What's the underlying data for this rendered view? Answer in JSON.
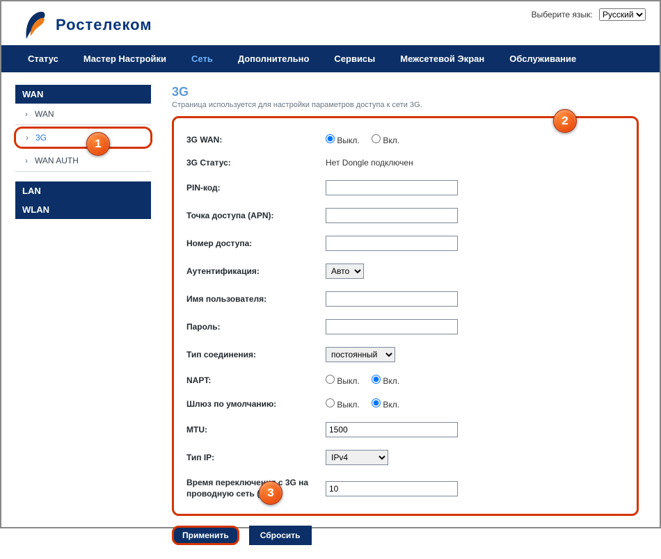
{
  "header": {
    "lang_label": "Выберите язык:",
    "lang_value": "Русский",
    "brand": "Ростелеком"
  },
  "nav": {
    "items": [
      "Статус",
      "Мастер Настройки",
      "Сеть",
      "Дополнительно",
      "Сервисы",
      "Межсетевой Экран",
      "Обслуживание"
    ],
    "active_index": 2
  },
  "sidebar": {
    "groups": [
      {
        "title": "WAN",
        "items": [
          "WAN",
          "3G",
          "WAN AUTH"
        ],
        "active_index": 1
      },
      {
        "title": "LAN",
        "items": []
      },
      {
        "title": "WLAN",
        "items": []
      }
    ]
  },
  "page": {
    "title": "3G",
    "desc": "Страница используется для настройки параметров доступа к сети 3G."
  },
  "form": {
    "wan": {
      "label": "3G WAN:",
      "off": "Выкл.",
      "on": "Вкл.",
      "value": "off"
    },
    "status": {
      "label": "3G Статус:",
      "value": "Нет Dongle подключен"
    },
    "pin": {
      "label": "PIN-код:",
      "value": ""
    },
    "apn": {
      "label": "Точка доступа (APN):",
      "value": ""
    },
    "dialnum": {
      "label": "Номер доступа:",
      "value": ""
    },
    "auth": {
      "label": "Аутентификация:",
      "value": "Авто"
    },
    "user": {
      "label": "Имя пользователя:",
      "value": ""
    },
    "pass": {
      "label": "Пароль:",
      "value": ""
    },
    "conn": {
      "label": "Тип соединения:",
      "value": "постоянный"
    },
    "napt": {
      "label": "NAPT:",
      "off": "Выкл.",
      "on": "Вкл.",
      "value": "on"
    },
    "gw": {
      "label": "Шлюз по умолчанию:",
      "off": "Выкл.",
      "on": "Вкл.",
      "value": "on"
    },
    "mtu": {
      "label": "MTU:",
      "value": "1500"
    },
    "iptype": {
      "label": "Тип IP:",
      "value": "IPv4"
    },
    "switchtime": {
      "label": "Время переключения с 3G на проводную сеть (c):",
      "value": "10"
    }
  },
  "buttons": {
    "apply": "Применить",
    "reset": "Сбросить"
  },
  "callouts": {
    "c1": "1",
    "c2": "2",
    "c3": "3"
  }
}
